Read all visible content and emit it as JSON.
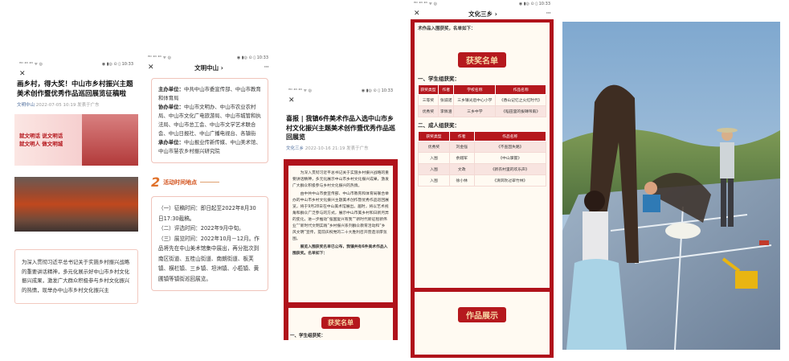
{
  "p1": {
    "status_left": "ᴴᴰ ⁴ᴳ ⁴ᴳ ᯤ ◎",
    "status_right": "◉ ▮◎ ⊙ ▯ 10:33",
    "title": "画乡村，得大奖！中山市乡村振兴主题美术创作暨优秀作品巡回展览征稿啦",
    "source": "文明中山",
    "date": "2022-07-05 10:19",
    "location": "发表于广东",
    "banner_slogan1": "就文明话 说文明话",
    "banner_slogan2": "就文明人 做文明城",
    "card_text": "为深入贯彻习近平总书记关于实施乡村振兴战略的重要讲话精神，多元化展示好中山市乡村文化振兴成果，激发广大群众积极参与乡村文化振兴的热情，现举办中山市乡村文化振兴主"
  },
  "p2": {
    "status_left": "ᴴᴰ ⁴ᴳ ⁴ᴳ ᯤ ◎",
    "status_right": "◉ ▮◎ ⊙ ▯ 10:33",
    "nav_title": "文明中山 ›",
    "host_label": "主办单位：",
    "host": "中共中山市委宣传部、中山市教育和体育局",
    "co_label": "协办单位：",
    "co": "中山市文明办、中山市农业农村局、中山市文化广电旅游局、中山市城管和执法局、中山市总工会、中山市文学艺术联合会、中山日报社、中山广播电视台、各镇街",
    "org_label": "承办单位：",
    "org": "中山报业传新传媒、中山美术馆、中山市慧农乡村振兴研究院",
    "section_num": "2",
    "section_title": "活动时间地点",
    "items": [
      "（一）征稿时间：即日起至2022年8月30日17:30截稿。",
      "（二）评选时间：2022年9月中旬。",
      "（三）展览时间：2022年10月－12月。作品将先在中山美术馆集中展出，再分批次到南区街道、五桂山街道、南朗街道、板芙镇、横栏镇、三乡镇、坦洲镇、小榄镇、黄圃镇等镇街巡回展览。"
    ]
  },
  "p3": {
    "status_left": "ᴴᴰ ⁴ᴳ ⁴ᴳ ᯤ ◎",
    "status_right": "◉ ▮◎ ⊙ ▯ 10:33",
    "title": "喜报 | 我镇6件美术作品入选中山市乡村文化振兴主题美术创作暨优秀作品巡回展览",
    "source": "文化三乡",
    "date": "2022-10-16 21:19",
    "location": "发表于广东",
    "para1": "为深入贯彻习近平总书记关于实施乡村振兴战略的重要讲话精神，多元化展示中山市乡村文化振兴成果，激发广大群众积极参与乡村文化振兴的热情。",
    "para2": "由中共中山市委宣传部、中山市教育和体育局联合举办的中山市乡村文化振兴主题美术创作暨优秀作品巡回展览，将于9月28日在中山美术馆展出。届时，将以艺术视角和群众广泛参与的方式，展示中山市美乡村和日新月异的变化，进一步推动“强国复兴有我”“新时代新征程新伟业”“新时代文明实践”乡村振兴系列群众教育活动和“乡风文明”宣传，提前庆祝党的二十大胜利召开营造浓厚氛围。",
    "para3": "展览入围获奖名单已公布，我镇共有6件美术作品入围获奖。名单如下：",
    "award_header": "获奖名单",
    "student_group": "一、学生组获奖："
  },
  "p4": {
    "status_left": "ᴴᴰ ⁴ᴳ ⁴ᴳ ᯤ ◎",
    "status_right": "◉ ▮◎ ⊙ ▯ 10:33",
    "nav_title": "文化三乡 ›",
    "top_text": "术作品入围获奖，名单如下：",
    "award_header": "获奖名单",
    "student_group": "一、学生组获奖：",
    "student_headers": [
      "获奖类型",
      "作者",
      "学校名称",
      "作品名称"
    ],
    "student_rows": [
      [
        "三等奖",
        "张诚诺",
        "三乡镇光后中心小学",
        "《香山记忆之火红时代》"
      ],
      [
        "优秀奖",
        "李佩涵",
        "三乡中学",
        "《稻田里的拔磚吊扇》"
      ]
    ],
    "adult_group": "二、成人组获奖：",
    "adult_headers": [
      "获奖类型",
      "作者",
      "作品名称"
    ],
    "adult_rows": [
      [
        "优秀奖",
        "刘金强",
        "《不查因失路》"
      ],
      [
        "入围",
        "余翔军",
        "《中山掌握》"
      ],
      [
        "入围",
        "文政",
        "《新农村里的欢乐声》"
      ],
      [
        "入围",
        "徐小林",
        "《清风吹过翠竹林》"
      ]
    ],
    "works_header": "作品展示"
  },
  "colors": {
    "accent_red": "#b5181e",
    "orange": "#e0712a",
    "cream": "#fffaf2"
  }
}
